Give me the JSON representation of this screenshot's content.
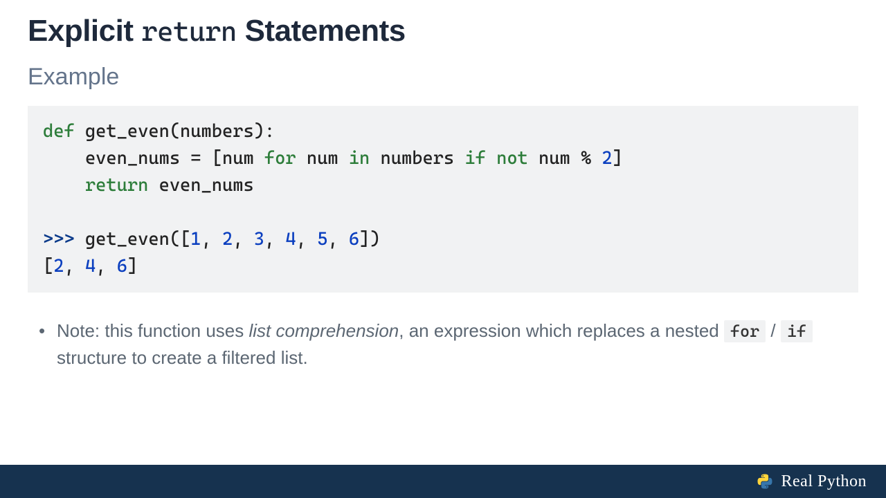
{
  "heading": {
    "part1": "Explicit ",
    "keyword": "return",
    "part2": "  Statements"
  },
  "subheading": "Example",
  "code": {
    "line1": {
      "def": "def",
      "name": " get_even(numbers):"
    },
    "line2": {
      "indent": "    even_nums = [num ",
      "for": "for",
      "mid1": " num ",
      "in": "in",
      "mid2": " numbers ",
      "if": "if",
      "mid3": " ",
      "not": "not",
      "mid4": " num % ",
      "two": "2",
      "end": "]"
    },
    "line3": {
      "indent": "    ",
      "return": "return",
      "rest": " even_nums"
    },
    "blank": "",
    "line4": {
      "prompt": ">>> ",
      "call": "get_even([",
      "n1": "1",
      "c1": ", ",
      "n2": "2",
      "c2": ", ",
      "n3": "3",
      "c3": ", ",
      "n4": "4",
      "c4": ", ",
      "n5": "5",
      "c5": ", ",
      "n6": "6",
      "end": "])"
    },
    "line5": {
      "open": "[",
      "r1": "2",
      "c1": ", ",
      "r2": "4",
      "c2": ", ",
      "r3": "6",
      "close": "]"
    }
  },
  "note": {
    "pre": "Note: this function uses ",
    "em": "list comprehension",
    "mid1": ", an expression which replaces a nested ",
    "code1": "for",
    "sep": " / ",
    "code2": "if",
    "post": " structure to create a filtered list."
  },
  "brand": "Real Python"
}
